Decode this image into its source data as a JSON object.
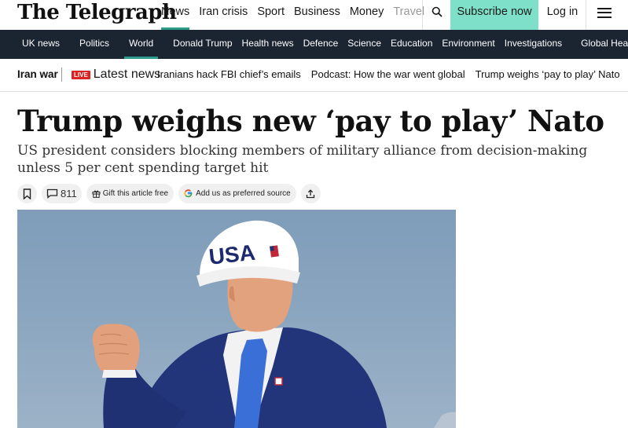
{
  "header": {
    "logo_text": "The Telegraph",
    "nav": [
      {
        "label": "News",
        "active": true
      },
      {
        "label": "Iran crisis"
      },
      {
        "label": "Sport"
      },
      {
        "label": "Business"
      },
      {
        "label": "Money"
      },
      {
        "label": "Travel"
      }
    ],
    "search_icon": "search-icon",
    "subscribe_label": "Subscribe now",
    "login_label": "Log in",
    "menu_icon": "hamburger-menu-icon",
    "accent_color": "#2c9b8c",
    "subscribe_color": "#7ee0c8"
  },
  "sections": {
    "items": [
      {
        "label": "UK news"
      },
      {
        "label": "Politics"
      },
      {
        "label": "World",
        "active": true
      },
      {
        "label": "Donald Trump"
      },
      {
        "label": "Health news"
      },
      {
        "label": "Defence"
      },
      {
        "label": "Science"
      },
      {
        "label": "Education"
      },
      {
        "label": "Environment"
      },
      {
        "label": "Investigations"
      },
      {
        "label": "Global Hea"
      }
    ],
    "background_color": "#1b2431"
  },
  "topics": {
    "label": "Iran war",
    "live_badge": "LIVE",
    "links": [
      {
        "label": "Latest news"
      },
      {
        "label": "Iranians hack FBI chief’s emails"
      },
      {
        "label": "Podcast: How the war went global"
      },
      {
        "label": "Trump weighs ‘pay to play’ Nato"
      }
    ]
  },
  "article": {
    "headline": "Trump weighs new ‘pay to play’ Nato",
    "standfirst": "US president considers blocking members of military alliance from decision-making unless 5 per cent spending target hit",
    "actions": {
      "bookmark_icon": "bookmark-icon",
      "comment_icon": "comment-icon",
      "comment_count": "811",
      "gift_icon": "gift-icon",
      "gift_label": "Gift this article free",
      "google_icon": "google-g-icon",
      "preferred_source_label": "Add us as preferred source",
      "share_icon": "share-icon"
    },
    "image": {
      "cap_text": "USA"
    }
  }
}
